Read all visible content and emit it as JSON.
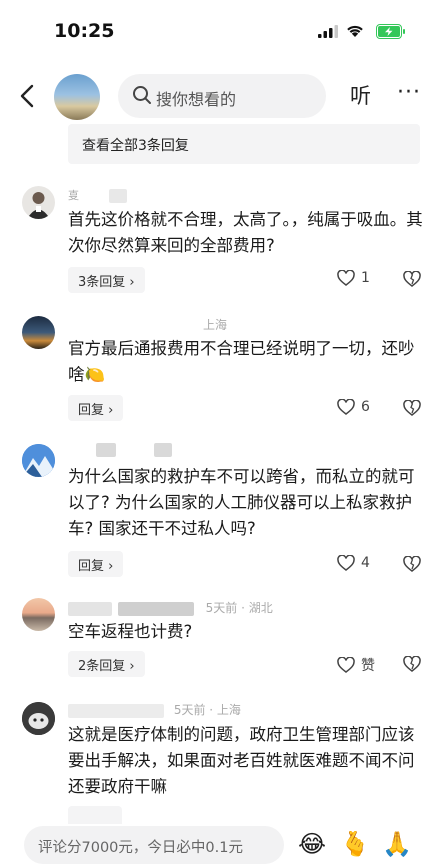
{
  "status": {
    "time": "10:25"
  },
  "header": {
    "search_placeholder": "搜你想看的",
    "listen_label": "听",
    "more_label": "···"
  },
  "view_all_replies": "查看全部3条回复",
  "comments": [
    {
      "meta_suffix": "",
      "text": "首先这价格就不合理，太高了。，纯属于吸血。其次你尽然算来回的全部费用?",
      "reply_label": "3条回复 ›",
      "likes": "1"
    },
    {
      "meta_suffix": "上海",
      "text": "官方最后通报费用不合理已经说明了一切，还吵啥",
      "reply_label": "回复 ›",
      "likes": "6"
    },
    {
      "meta_suffix": "",
      "text": "为什么国家的救护车不可以跨省，而私立的就可以了? 为什么国家的人工肺仪器可以上私家救护车? 国家还干不过私人吗?",
      "reply_label": "回复 ›",
      "likes": "4"
    },
    {
      "meta_suffix": "5天前 · 湖北",
      "text": "空车返程也计费?",
      "reply_label": "2条回复 ›",
      "likes": "赞"
    },
    {
      "meta_suffix": "5天前 · 上海",
      "text": "这就是医疗体制的问题，政府卫生管理部门应该要出手解决，如果面对老百姓就医难题不闻不问还要政府干嘛",
      "reply_label": "",
      "likes": ""
    }
  ],
  "bottom": {
    "input_placeholder": "评论分7000元，今日必中0.1元"
  },
  "colors": {
    "accent_battery": "#34c759",
    "reply_bg": "#f4f4f5"
  }
}
